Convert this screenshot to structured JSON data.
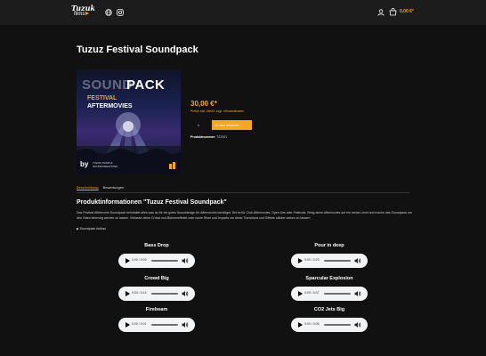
{
  "header": {
    "logo_line1": "Tuzuk",
    "logo_line2": "films",
    "cart_total": "0,00 €*",
    "icons": [
      "globe-icon",
      "instagram-icon",
      "user-icon",
      "cart-icon"
    ]
  },
  "product": {
    "title": "Tuzuz Festival Soundpack",
    "cover": {
      "line1a": "SOUND",
      "line1b": "PACK",
      "line2": "FESTIVAL",
      "line3": "AFTERMOVIES",
      "by": "by",
      "small": "TUZUK FILMS & SOUNDCREATIONS"
    },
    "price": "30,00 €*",
    "vat_note": "Preise inkl. MwSt. zzgl. Versandkosten",
    "quantity": "1",
    "buy_label": "In den Warenk...",
    "sku_label": "Produktnummer:",
    "sku_value": "TZ2001"
  },
  "tabs": {
    "description": "Beschreibung",
    "reviews": "Bewertungen"
  },
  "info": {
    "heading": "Produktinformationen \"Tuzuz Festival Soundpack\"",
    "paragraph": "Das Festival Aftermovie Soundpack beinhaltet alles was du für ein gutes Sounddesign für Aftermovies benötigst. Sei es für Club-Aftermovies, Open Airs oder Festivals. Bring deine Aftermovies auf ein neues Level und mache das Soundpack um den Video lebendig werden zu lassen. Verlasse deine Crowd und Bühneneffekte oder nutze Riser und Impacts um deine Transitions und Effekte stärker wirken zu lassen!",
    "details_label": "▶ Soundpack Aufbau"
  },
  "audio": [
    {
      "title": "Bass Drop",
      "time": "0:00 / 0:09"
    },
    {
      "title": "Pour in deep",
      "time": "0:00 / 0:23"
    },
    {
      "title": "Crowd Big",
      "time": "0:00 / 0:14"
    },
    {
      "title": "Sparcular Explosion",
      "time": "0:00 / 0:07"
    },
    {
      "title": "Firebeam",
      "time": "0:00 / 0:01"
    },
    {
      "title": "CO2 Jets Big",
      "time": "0:00 / 0:06"
    }
  ],
  "colors": {
    "accent": "#f5a623",
    "background": "#111111",
    "topbar": "#1c1c1c"
  }
}
